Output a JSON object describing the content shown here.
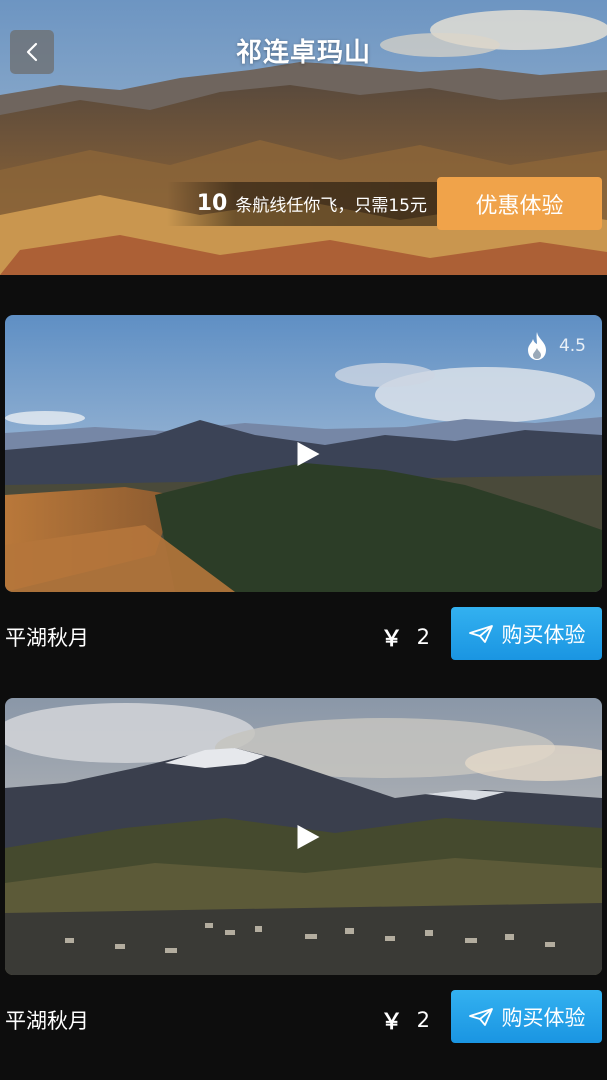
{
  "header": {
    "title": "祁连卓玛山",
    "back_icon": "chevron-left-icon"
  },
  "promo": {
    "count": "10",
    "text": "条航线任你飞，只需15元",
    "button_label": "优惠体验",
    "button_color": "#f0a34a"
  },
  "routes": [
    {
      "name": "平湖秋月",
      "currency": "￥",
      "price": "2",
      "button_label": "购买体验",
      "hot_icon": "flame-icon",
      "hot_value": "4.5",
      "play_icon": "play-icon"
    },
    {
      "name": "平湖秋月",
      "currency": "￥",
      "price": "2",
      "button_label": "购买体验",
      "play_icon": "play-icon"
    }
  ],
  "colors": {
    "background": "#0d0d0d",
    "buy_button": "#1a95e2",
    "promo_button": "#f0a34a"
  }
}
